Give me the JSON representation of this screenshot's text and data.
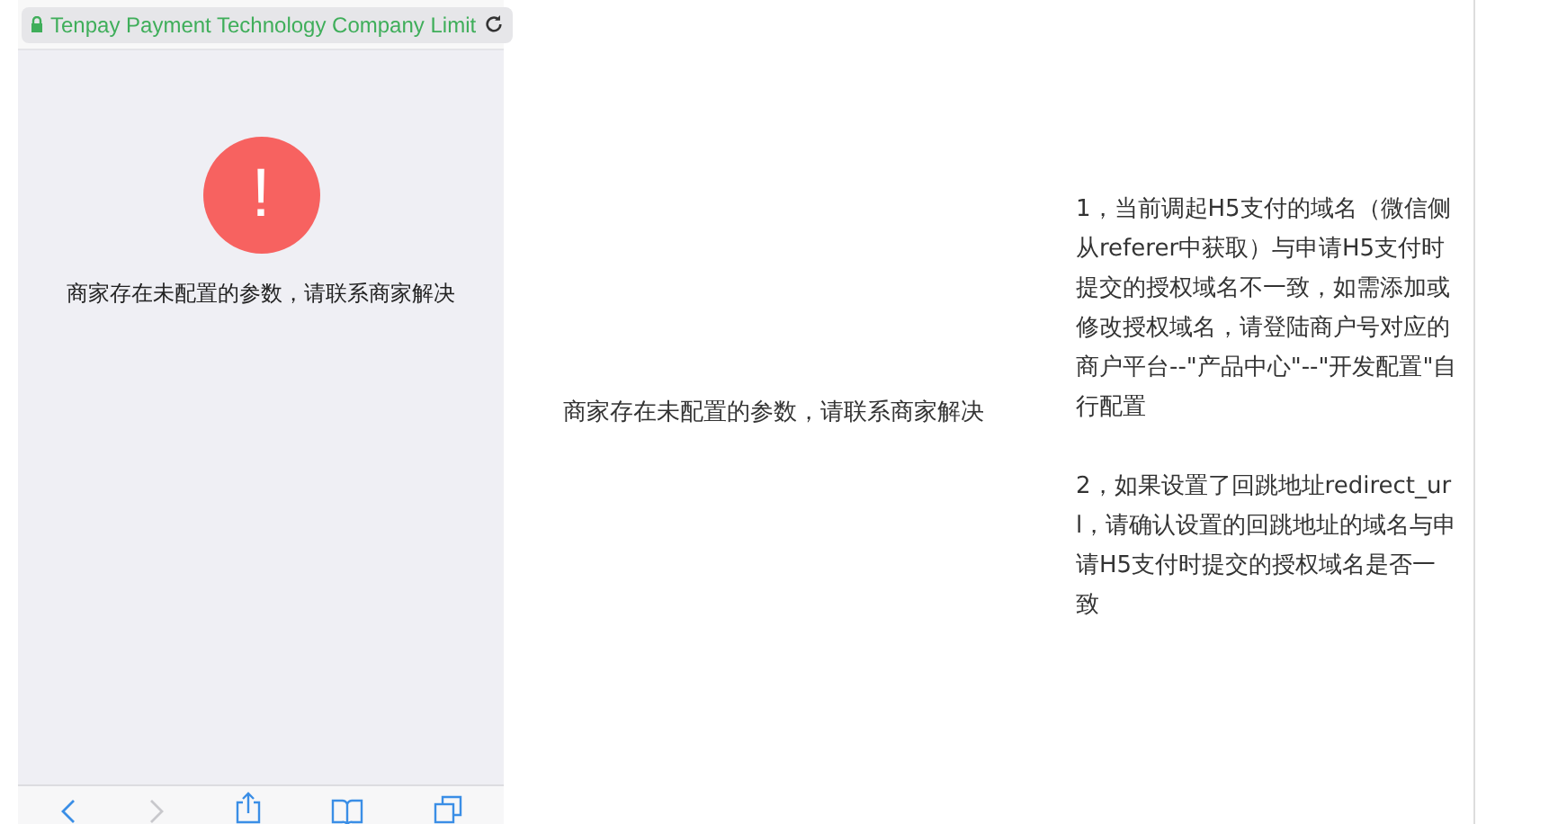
{
  "phone": {
    "url": "Tenpay Payment Technology Company Limit",
    "alert_symbol": "!",
    "message": "商家存在未配置的参数，请联系商家解决"
  },
  "middle_text": "商家存在未配置的参数，请联系商家解决",
  "notes": [
    "1，当前调起H5支付的域名（微信侧从referer中获取）与申请H5支付时提交的授权域名不一致，如需添加或修改授权域名，请登陆商户号对应的商户平台--\"产品中心\"--\"开发配置\"自行配置",
    "2，如果设置了回跳地址redirect_url，请确认设置的回跳地址的域名与申请H5支付时提交的授权域名是否一致"
  ]
}
